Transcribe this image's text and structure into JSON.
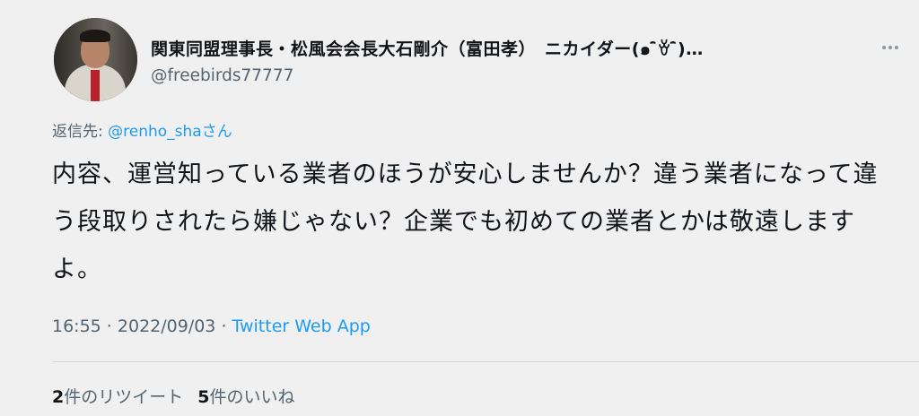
{
  "author": {
    "display_name": "関東同盟理事長・松風会会長大石剛介（富田孝）　ニカイダー(๑ ̄̑ꈊ ̄̑)…",
    "handle": "@freebirds77777"
  },
  "reply": {
    "prefix": "返信先: ",
    "mention": "@renho_sha",
    "suffix": "さん"
  },
  "tweet": {
    "text": "内容、運営知っている業者のほうが安心しませんか？違う業者になって違う段取りされたら嫌じゃない？企業でも初めての業者とかは敬遠しますよ。"
  },
  "meta": {
    "time": "16:55",
    "separator1": " · ",
    "date": "2022/09/03",
    "separator2": " · ",
    "source": "Twitter Web App"
  },
  "stats": {
    "retweets_count": "2",
    "retweets_label": "件のリツイート",
    "likes_count": "5",
    "likes_label": "件のいいね"
  },
  "icons": {
    "more": "more-horizontal-icon",
    "avatar": "profile-photo"
  }
}
